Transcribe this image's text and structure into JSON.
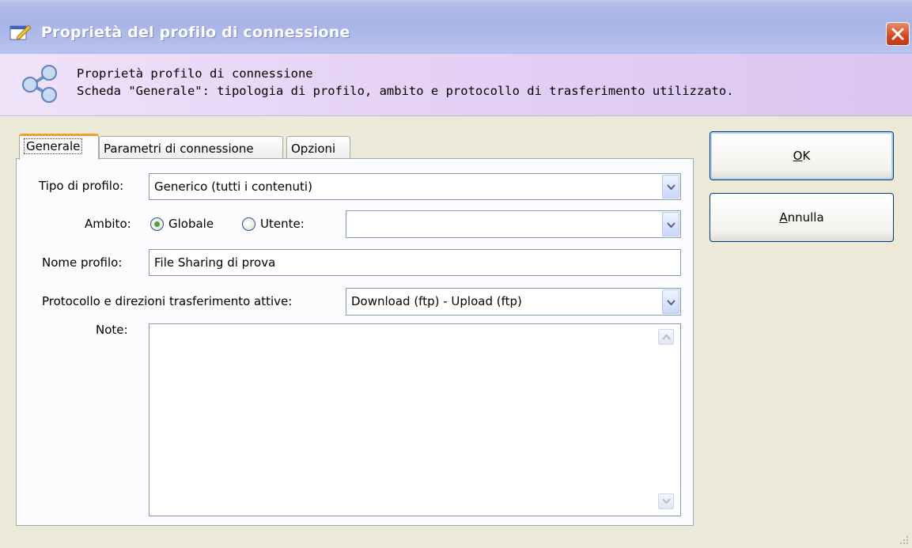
{
  "window": {
    "title": "Proprietà del profilo di connessione",
    "close_glyph": "close-icon",
    "title_color": "#ffffff",
    "titlebar_color": "#aab6e6"
  },
  "header": {
    "icon": "share-icon",
    "line1": "Proprietà profilo di connessione",
    "line2": "Scheda \"Generale\": tipologia di profilo, ambito e protocollo di trasferimento utilizzato."
  },
  "tabs": [
    {
      "label": "Generale",
      "active": true
    },
    {
      "label": "Parametri di connessione",
      "active": false
    },
    {
      "label": "Opzioni",
      "active": false
    }
  ],
  "form": {
    "tipo_label": "Tipo di profilo:",
    "tipo_value": "Generico (tutti i contenuti)",
    "ambito_label": "Ambito:",
    "ambito_globale": "Globale",
    "ambito_utente": "Utente:",
    "ambito_selected": "Globale",
    "utente_value": "",
    "nome_label": "Nome profilo:",
    "nome_value": "File Sharing di prova",
    "protocollo_label": "Protocollo e direzioni trasferimento attive:",
    "protocollo_value": "Download (ftp) - Upload (ftp)",
    "note_label": "Note:",
    "note_value": ""
  },
  "buttons": {
    "ok": {
      "mnemonic": "O",
      "rest": "K"
    },
    "annulla": {
      "mnemonic": "A",
      "rest": "nnulla"
    }
  }
}
